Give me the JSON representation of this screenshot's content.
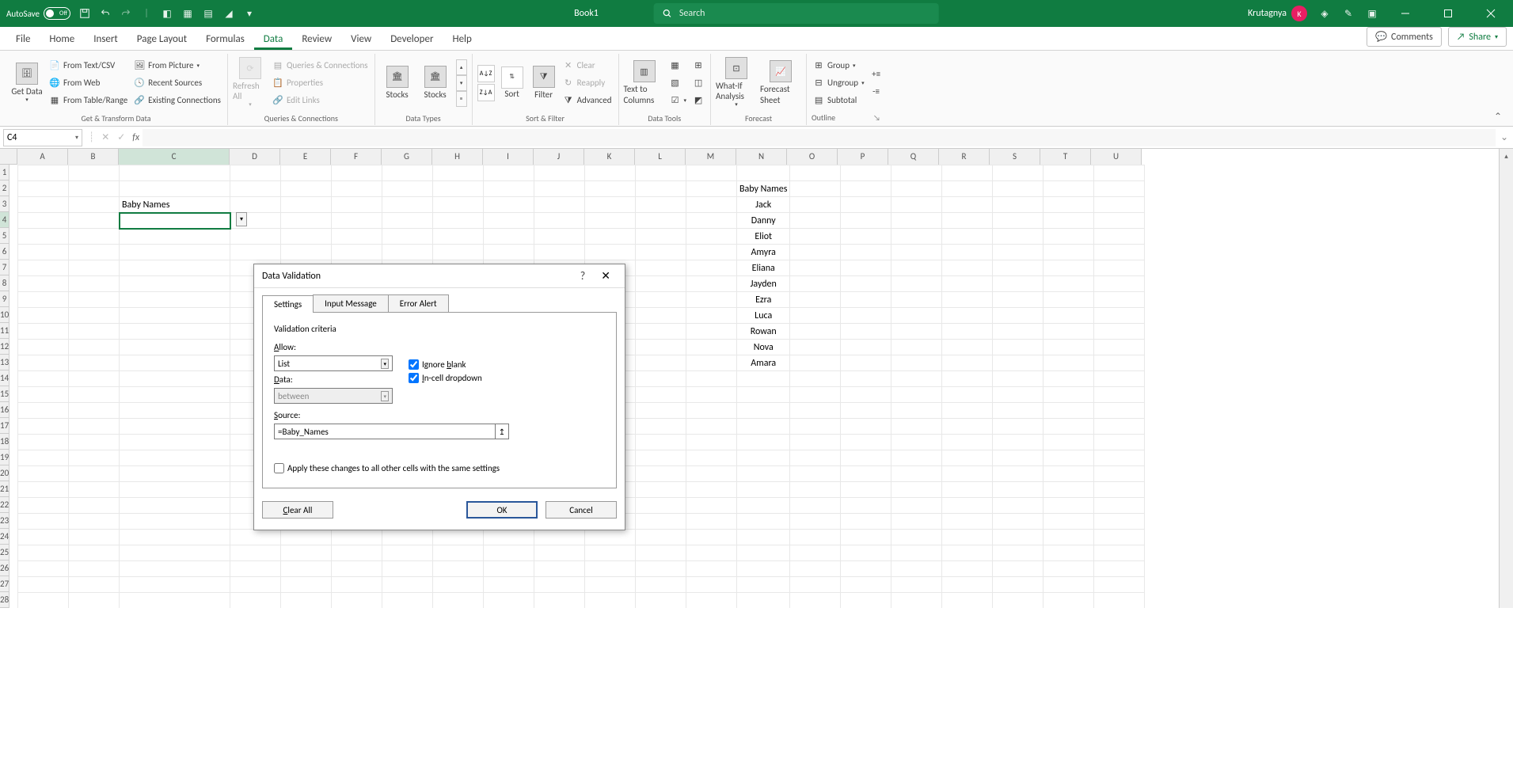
{
  "titlebar": {
    "autosave_label": "AutoSave",
    "autosave_state": "Off",
    "book_title": "Book1",
    "search_placeholder": "Search",
    "username": "Krutagnya",
    "avatar_letter": "K"
  },
  "tabs": [
    "File",
    "Home",
    "Insert",
    "Page Layout",
    "Formulas",
    "Data",
    "Review",
    "View",
    "Developer",
    "Help"
  ],
  "active_tab": "Data",
  "topright": {
    "comments": "Comments",
    "share": "Share"
  },
  "ribbon": {
    "get_data": {
      "big": "Get Data",
      "items": [
        "From Text/CSV",
        "From Web",
        "From Table/Range",
        "From Picture",
        "Recent Sources",
        "Existing Connections"
      ],
      "group": "Get & Transform Data"
    },
    "refresh": {
      "big": "Refresh All",
      "items": [
        "Queries & Connections",
        "Properties",
        "Edit Links"
      ],
      "group": "Queries & Connections"
    },
    "datatypes": {
      "stocks1": "Stocks",
      "stocks2": "Stocks",
      "group": "Data Types"
    },
    "sortfilter": {
      "sort": "Sort",
      "filter": "Filter",
      "clear": "Clear",
      "reapply": "Reapply",
      "advanced": "Advanced",
      "group": "Sort & Filter"
    },
    "datatools": {
      "t2c": "Text to Columns",
      "group": "Data Tools"
    },
    "forecast": {
      "whatif": "What-If Analysis",
      "sheet": "Forecast Sheet",
      "group": "Forecast"
    },
    "outline": {
      "grp": "Group",
      "ungrp": "Ungroup",
      "subtotal": "Subtotal",
      "group": "Outline"
    }
  },
  "formulabar": {
    "namebox": "C4",
    "formula": ""
  },
  "sheet": {
    "cols": [
      "A",
      "B",
      "C",
      "D",
      "E",
      "F",
      "G",
      "H",
      "I",
      "J",
      "K",
      "L",
      "M",
      "N",
      "O",
      "P",
      "Q",
      "R",
      "S",
      "T",
      "U"
    ],
    "row_count": 29,
    "c3": "Baby Names",
    "n2": "Baby Names",
    "n_list": [
      "Jack",
      "Danny",
      "Eliot",
      "Amyra",
      "Eliana",
      "Jayden",
      "Ezra",
      "Luca",
      "Rowan",
      "Nova",
      "Amara"
    ],
    "active": "C4"
  },
  "dialog": {
    "title": "Data Validation",
    "tabs": [
      "Settings",
      "Input Message",
      "Error Alert"
    ],
    "active_tab": "Settings",
    "criteria_label": "Validation criteria",
    "allow_label": "Allow:",
    "allow_value": "List",
    "ignore_blank": "Ignore blank",
    "incell_dd": "In-cell dropdown",
    "data_label": "Data:",
    "data_value": "between",
    "source_label": "Source:",
    "source_value": "=Baby_Names",
    "apply_label": "Apply these changes to all other cells with the same settings",
    "clear": "Clear All",
    "ok": "OK",
    "cancel": "Cancel"
  }
}
